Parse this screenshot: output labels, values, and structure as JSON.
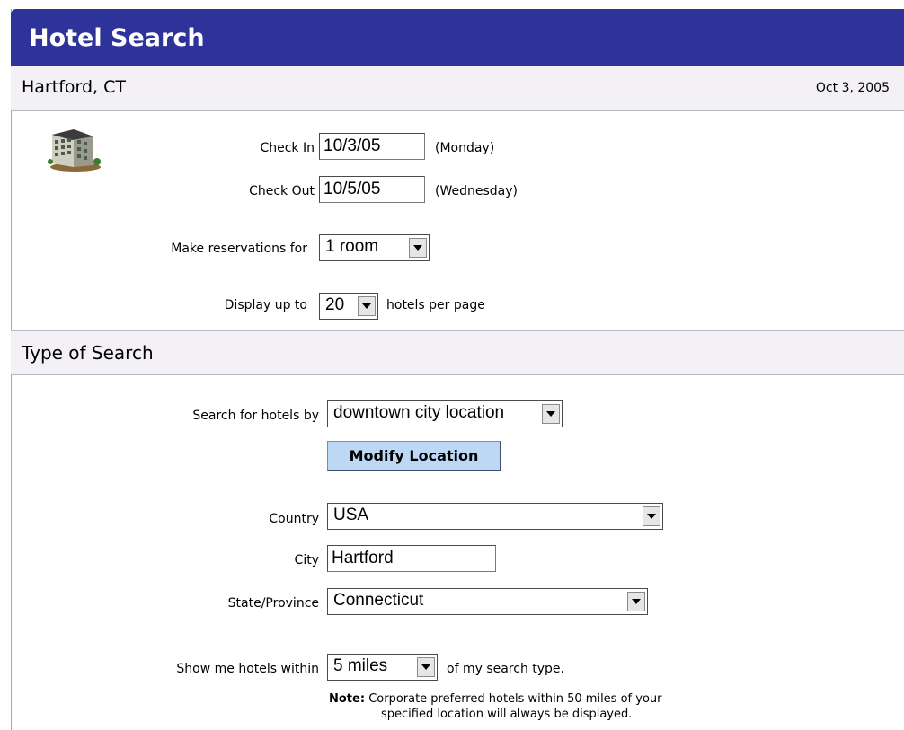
{
  "header": {
    "title": "Hotel Search"
  },
  "location_bar": {
    "city": "Hartford, CT",
    "date": "Oct 3, 2005"
  },
  "dates": {
    "check_in_label": "Check In",
    "check_in_value": "10/3/05",
    "check_in_day": "(Monday)",
    "check_out_label": "Check Out",
    "check_out_value": "10/5/05",
    "check_out_day": "(Wednesday)"
  },
  "reservations": {
    "label": "Make reservations for",
    "selected": "1 room"
  },
  "display": {
    "label": "Display up to",
    "selected": "20",
    "suffix": "hotels per page"
  },
  "search_type": {
    "section_title": "Type of Search",
    "by_label": "Search for hotels by",
    "by_selected": "downtown city location",
    "modify_button": "Modify Location"
  },
  "location": {
    "country_label": "Country",
    "country_selected": "USA",
    "city_label": "City",
    "city_value": "Hartford",
    "state_label": "State/Province",
    "state_selected": "Connecticut"
  },
  "radius": {
    "label": "Show me hotels within",
    "selected": "5 miles",
    "suffix": "of my search type."
  },
  "note": {
    "label": "Note:",
    "line1": "Corporate preferred hotels within 50 miles of your",
    "line2": "specified location will always be displayed."
  },
  "colors": {
    "title_bar": "#2e339a",
    "section_bg": "#f3f1f6",
    "button_bg": "#bcd8f5"
  },
  "icons": {
    "hotel": "hotel-building-icon",
    "dropdown": "chevron-down-icon"
  }
}
